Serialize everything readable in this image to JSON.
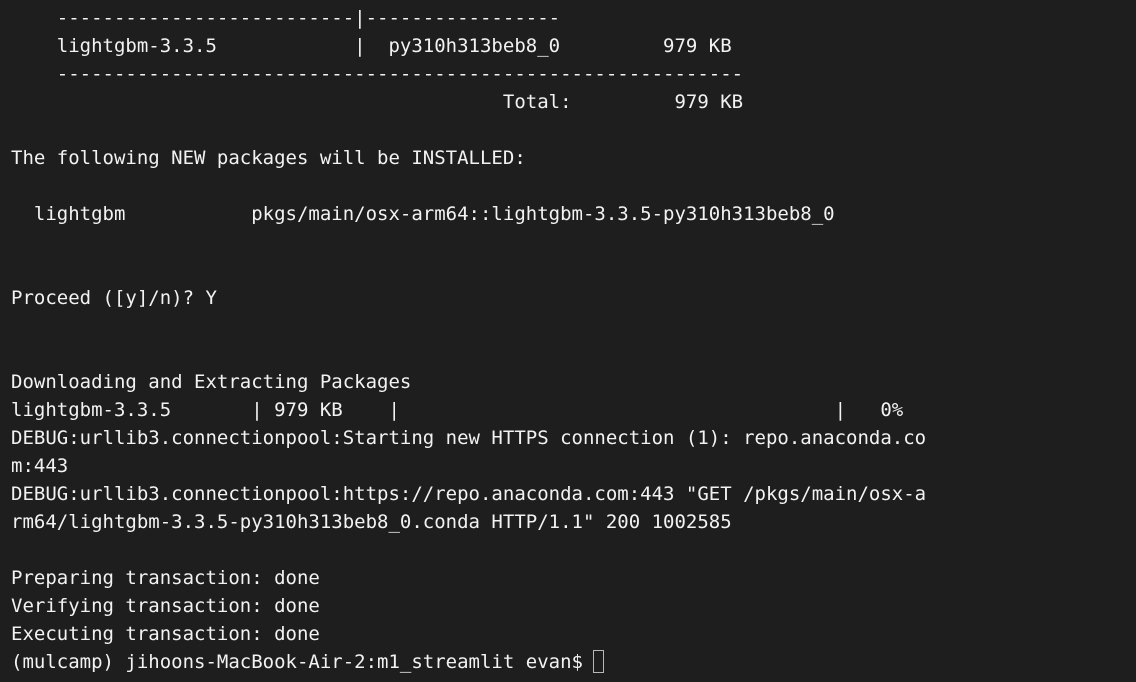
{
  "terminal": {
    "lines": [
      "    --------------------------|-----------------",
      "    lightgbm-3.3.5            |  py310h313beb8_0         979 KB",
      "    ------------------------------------------------------------",
      "                                           Total:         979 KB",
      "",
      "The following NEW packages will be INSTALLED:",
      "",
      "  lightgbm           pkgs/main/osx-arm64::lightgbm-3.3.5-py310h313beb8_0",
      "",
      "",
      "Proceed ([y]/n)? Y",
      "",
      "",
      "Downloading and Extracting Packages",
      "lightgbm-3.3.5       | 979 KB    |                                      |   0%",
      "DEBUG:urllib3.connectionpool:Starting new HTTPS connection (1): repo.anaconda.co",
      "m:443",
      "DEBUG:urllib3.connectionpool:https://repo.anaconda.com:443 \"GET /pkgs/main/osx-a",
      "rm64/lightgbm-3.3.5-py310h313beb8_0.conda HTTP/1.1\" 200 1002585",
      "",
      "Preparing transaction: done",
      "Verifying transaction: done",
      "Executing transaction: done"
    ],
    "prompt": "(mulcamp) jihoons-MacBook-Air-2:m1_streamlit evan$"
  }
}
